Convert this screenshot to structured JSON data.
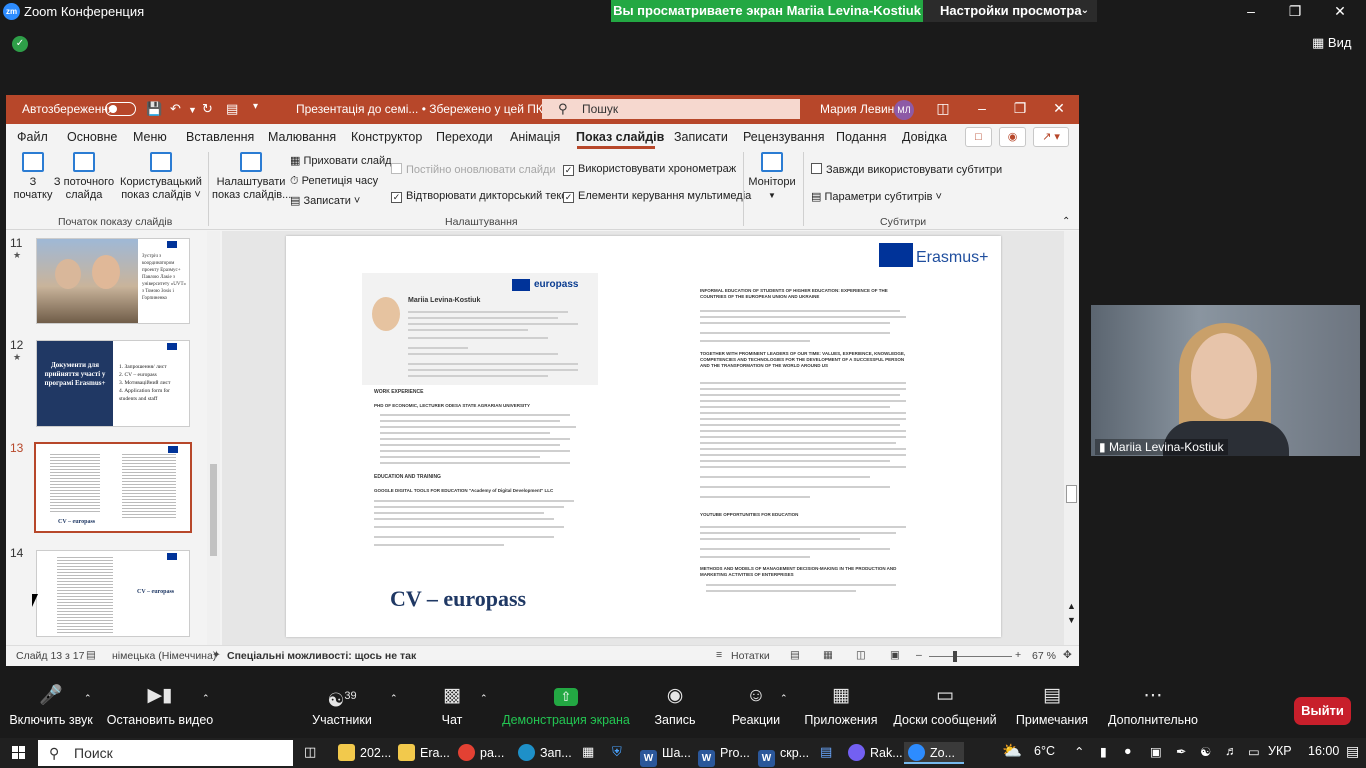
{
  "zoom": {
    "logo": "zm",
    "window_title": "Zoom Конференция",
    "share_banner": "Вы просматриваете экран Mariia Levina-Kostiuk",
    "view_settings": "Настройки просмотра",
    "view_button": "Вид",
    "participant_name": "Mariia Levina-Kostiuk",
    "toolbar": [
      {
        "label": "Включить звук",
        "icon": "mic-off-icon"
      },
      {
        "label": "Остановить видео",
        "icon": "video-camera-icon"
      },
      {
        "label": "Участники",
        "icon": "participants-icon",
        "count": "39"
      },
      {
        "label": "Чат",
        "icon": "chat-icon"
      },
      {
        "label": "Демонстрация экрана",
        "icon": "share-screen-icon"
      },
      {
        "label": "Запись",
        "icon": "record-icon"
      },
      {
        "label": "Реакции",
        "icon": "reactions-icon"
      },
      {
        "label": "Приложения",
        "icon": "apps-icon"
      },
      {
        "label": "Доски сообщений",
        "icon": "whiteboard-icon"
      },
      {
        "label": "Примечания",
        "icon": "notes-icon"
      },
      {
        "label": "Дополнительно",
        "icon": "more-icon"
      }
    ],
    "leave_button": "Выйти",
    "share_color": "#23a843",
    "leave_color": "#c81f2b"
  },
  "ppt": {
    "autosave_label": "Автозбереження",
    "autosave_state": "Вимк.",
    "doc_title": "Презентація до семі... • Збережено у цей ПК ˅",
    "search_placeholder": "Пошук",
    "user_name": "Мария Левина",
    "user_initials": "МЛ",
    "accent_color": "#b7472a",
    "menu": [
      "Файл",
      "Основне",
      "Меню",
      "Вставлення",
      "Малювання",
      "Конструктор",
      "Переходи",
      "Анімація",
      "Показ слайдів",
      "Записати",
      "Рецензування",
      "Подання",
      "Довідка"
    ],
    "active_menu": "Показ слайдів",
    "ribbon": {
      "from_start": "З\nпочатку",
      "from_current": "З поточного\nслайда",
      "custom_show": "Користувацький\nпоказ слайдів ˅",
      "group_start": "Початок показу слайдів",
      "setup_show": "Налаштувати\nпоказ слайдів...",
      "hide_slide": "Приховати слайд",
      "rehearse": "Репетиція часу",
      "record": "Записати ˅",
      "keep_updated": "Постійно оновлювати слайди",
      "play_narrations": "Відтворювати дикторський текст",
      "use_timings": "Використовувати хронометраж",
      "media_controls": "Елементи керування мультимедіа",
      "group_setup": "Налаштування",
      "monitors": "Монітори",
      "always_subtitles": "Завжди використовувати субтитри",
      "subtitle_settings": "Параметри субтитрів ˅",
      "group_subtitles": "Субтитри"
    },
    "thumbnails": [
      {
        "num": "11",
        "star": "★",
        "text": "Зустріч з координатором проекту Еразмус+ Пaвлою Лакіе з університету «UVT» з Томою Зosis і Горпиненко"
      },
      {
        "num": "12",
        "star": "★",
        "title": "Документи для прийняття участі у програмі Erasmus+",
        "items": [
          "1. Запрошення/ лист",
          "2. CV – europass",
          "3. Мотиваційний лист",
          "4. Application form for students and staff"
        ]
      },
      {
        "num": "13",
        "caption": "CV – europass"
      },
      {
        "num": "14",
        "caption": "CV – europass"
      }
    ],
    "slide": {
      "erasmus": "Erasmus+",
      "europass": "europass",
      "cv_name": "Mariia Levina-Kostiuk",
      "title": "CV – europass",
      "sections": [
        "WORK EXPERIENCE",
        "EDUCATION AND TRAINING"
      ],
      "r_headings": [
        "INFORMAL EDUCATION OF STUDENTS OF HIGHER EDUCATION: EXPERIENCE OF THE COUNTRIES OF THE EUROPEAN UNION AND UKRAINE",
        "TOGETHER WITH PROMINENT LEADERS OF OUR TIME: VALUES, EXPERIENCE, KNOWLEDGE, COMPETENCIES AND TECHNOLOGIES FOR THE DEVELOPMENT OF A SUCCESSFUL PERSON AND THE TRANSFORMATION OF THE WORLD AROUND US",
        "YOUTUBE OPPORTUNITIES FOR EDUCATION",
        "METHODS AND MODELS OF MANAGEMENT DECISION-MAKING IN THE PRODUCTION AND MARKETING ACTIVITIES OF ENTERPRISES"
      ],
      "l_headings": [
        "PHD OF ECONOMIC, LECTURER ODESA STATE AGRARIAN UNIVERSITY",
        "GOOGLE DIGITAL TOOLS FOR EDUCATION \"Academy of Digital Development\" LLC"
      ]
    },
    "status": {
      "slide_of": "Слайд 13 з 17",
      "language": "німецька (Німеччина)",
      "accessibility": "Спеціальні можливості: щось не так",
      "notes": "Нотатки",
      "zoom": "67 %"
    }
  },
  "taskbar": {
    "search": "Поиск",
    "apps": [
      {
        "label": "202...",
        "icon": "folder-icon",
        "color": "#f2c94c"
      },
      {
        "label": "Era...",
        "icon": "folder-icon",
        "color": "#f2c94c"
      },
      {
        "label": "ра...",
        "icon": "chrome-icon",
        "color": "#e34133"
      },
      {
        "label": "Зап...",
        "icon": "edge-icon",
        "color": "#1e90c8"
      },
      {
        "label": "Ша...",
        "icon": "word-icon",
        "color": "#2b579a"
      },
      {
        "label": "Pro...",
        "icon": "word-icon",
        "color": "#2b579a"
      },
      {
        "label": "скр...",
        "icon": "word-icon",
        "color": "#2b579a"
      },
      {
        "label": "Rak...",
        "icon": "viber-icon",
        "color": "#7360f2"
      },
      {
        "label": "Zo...",
        "icon": "zoom-icon",
        "color": "#2d8cff"
      }
    ],
    "temperature": "6°C",
    "lang": "УКР",
    "time": "16:00"
  }
}
